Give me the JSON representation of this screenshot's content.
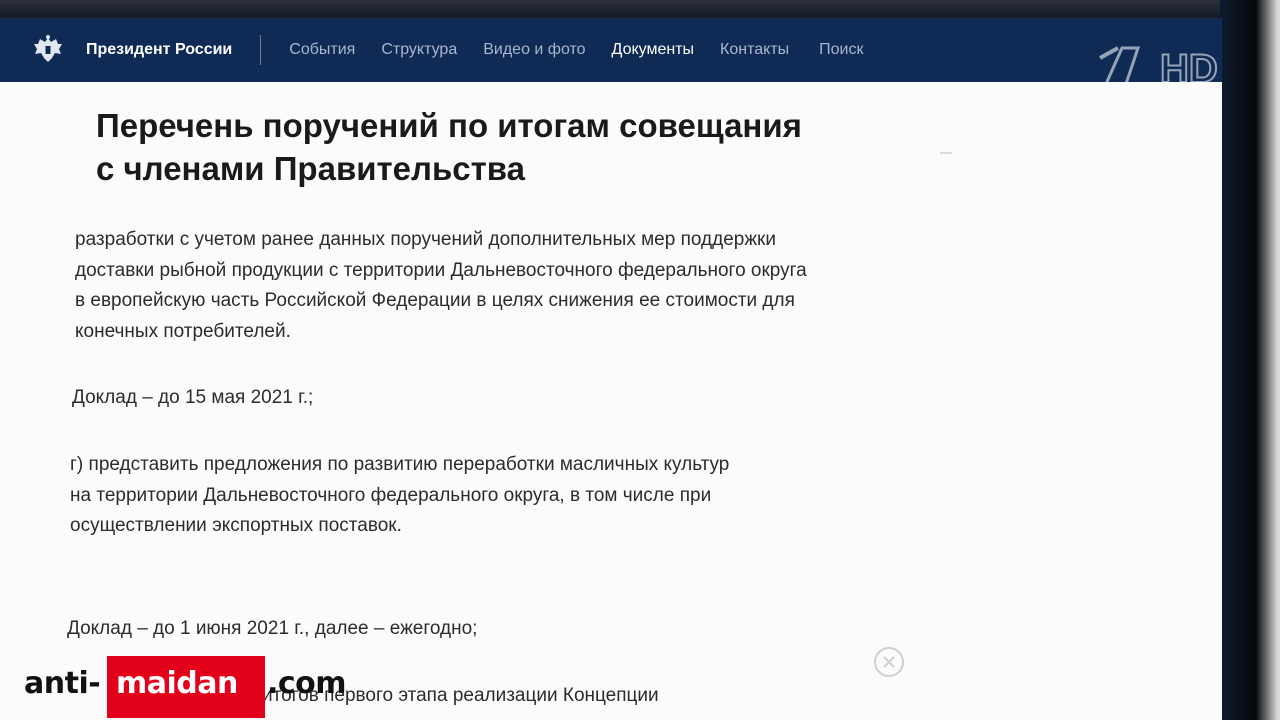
{
  "navbar": {
    "brand": "Президент России",
    "items": [
      "События",
      "Структура",
      "Видео и фото",
      "Документы",
      "Контакты",
      "Поиск"
    ],
    "active_item": "Документы"
  },
  "channel_logo": {
    "text": "1 HD"
  },
  "document": {
    "title_line1": "Перечень поручений по итогам совещания",
    "title_line2": "с членами Правительства",
    "paragraphs": [
      [
        "разработки с учетом ранее данных поручений дополнительных мер поддержки",
        "доставки рыбной продукции с территории Дальневосточного федерального округа",
        "в европейскую часть Российской Федерации в целях снижения ее стоимости для",
        "конечных потребителей."
      ],
      [
        "Доклад – до 15 мая 2021 г.;"
      ],
      [
        "г) представить предложения по развитию переработки масличных культур",
        "на территории Дальневосточного федерального округа, в том числе при",
        "осуществлении экспортных поставок."
      ],
      [
        "Доклад – до 1 июня 2021 г., далее – ежегодно;"
      ],
      [
        "итогов первого этапа реализации Концепции"
      ]
    ]
  },
  "watermark": {
    "anti": "anti-",
    "maidan": "maidan",
    "com": ".com"
  },
  "colors": {
    "navbar": "#0e2a55",
    "accent_red": "#e2001a"
  }
}
